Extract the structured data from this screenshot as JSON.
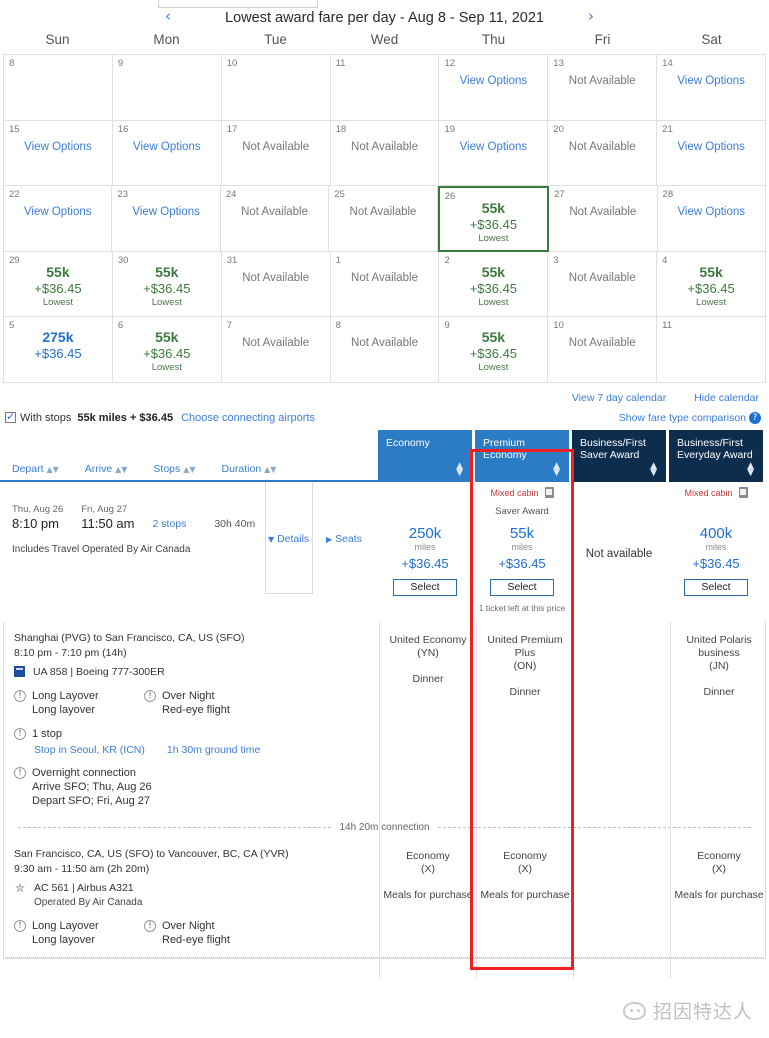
{
  "calendar": {
    "title": "Lowest award fare per day - Aug 8 - Sep 11, 2021",
    "prev_icon": "‹",
    "next_icon": "›",
    "weekdays": [
      "Sun",
      "Mon",
      "Tue",
      "Wed",
      "Thu",
      "Fri",
      "Sat"
    ],
    "link_label": "View Options",
    "na_label": "Not Available",
    "lowest_label": "Lowest",
    "colors": {
      "lowest_green": "#3d7a3d",
      "price_blue": "#1f6fd0",
      "link_blue": "#3b7dd8",
      "selected_border": "#3d7a3d"
    },
    "rows": [
      [
        {
          "day": "8",
          "state": "empty"
        },
        {
          "day": "9",
          "state": "empty"
        },
        {
          "day": "10",
          "state": "empty"
        },
        {
          "day": "11",
          "state": "empty"
        },
        {
          "day": "12",
          "state": "link"
        },
        {
          "day": "13",
          "state": "na"
        },
        {
          "day": "14",
          "state": "link"
        }
      ],
      [
        {
          "day": "15",
          "state": "link"
        },
        {
          "day": "16",
          "state": "link"
        },
        {
          "day": "17",
          "state": "na"
        },
        {
          "day": "18",
          "state": "na"
        },
        {
          "day": "19",
          "state": "link"
        },
        {
          "day": "20",
          "state": "na"
        },
        {
          "day": "21",
          "state": "link"
        }
      ],
      [
        {
          "day": "22",
          "state": "link"
        },
        {
          "day": "23",
          "state": "link"
        },
        {
          "day": "24",
          "state": "na"
        },
        {
          "day": "25",
          "state": "na"
        },
        {
          "day": "26",
          "state": "fare",
          "miles": "55k",
          "cash": "+$36.45",
          "lowest": "Lowest",
          "tone": "green",
          "selected": true
        },
        {
          "day": "27",
          "state": "na"
        },
        {
          "day": "28",
          "state": "link"
        }
      ],
      [
        {
          "day": "29",
          "state": "fare",
          "miles": "55k",
          "cash": "+$36.45",
          "lowest": "Lowest",
          "tone": "green"
        },
        {
          "day": "30",
          "state": "fare",
          "miles": "55k",
          "cash": "+$36.45",
          "lowest": "Lowest",
          "tone": "green"
        },
        {
          "day": "31",
          "state": "na"
        },
        {
          "day": "1",
          "state": "na"
        },
        {
          "day": "2",
          "state": "fare",
          "miles": "55k",
          "cash": "+$36.45",
          "lowest": "Lowest",
          "tone": "green"
        },
        {
          "day": "3",
          "state": "na"
        },
        {
          "day": "4",
          "state": "fare",
          "miles": "55k",
          "cash": "+$36.45",
          "lowest": "Lowest",
          "tone": "green"
        }
      ],
      [
        {
          "day": "5",
          "state": "fare",
          "miles": "275k",
          "cash": "+$36.45",
          "lowest": "",
          "tone": "blue"
        },
        {
          "day": "6",
          "state": "fare",
          "miles": "55k",
          "cash": "+$36.45",
          "lowest": "Lowest",
          "tone": "green"
        },
        {
          "day": "7",
          "state": "na"
        },
        {
          "day": "8",
          "state": "na"
        },
        {
          "day": "9",
          "state": "fare",
          "miles": "55k",
          "cash": "+$36.45",
          "lowest": "Lowest",
          "tone": "green"
        },
        {
          "day": "10",
          "state": "na"
        },
        {
          "day": "11",
          "state": "empty"
        }
      ]
    ],
    "footer_links": [
      "View 7 day calendar",
      "Hide calendar"
    ]
  },
  "filters": {
    "with_stops_label": "With stops",
    "with_stops_price": "55k miles + $36.45",
    "choose_airports": "Choose connecting airports",
    "fare_comparison": "Show fare type comparison",
    "help_icon": "?"
  },
  "sort": {
    "items": [
      "Depart",
      "Arrive",
      "Stops",
      "Duration"
    ],
    "sort_icon": "▴▾"
  },
  "fare_columns": [
    {
      "label": "Economy",
      "tone": "lite"
    },
    {
      "label": "Premium Economy",
      "tone": "lite"
    },
    {
      "label": "Business/First Saver Award",
      "tone": "dark"
    },
    {
      "label": "Business/First Everyday Award",
      "tone": "dark"
    }
  ],
  "flight": {
    "depart_date": "Thu, Aug 26",
    "depart_time": "8:10 pm",
    "arrive_date": "Fri, Aug 27",
    "arrive_time": "11:50 am",
    "stops": "2 stops",
    "duration": "30h 40m",
    "note": "Includes Travel Operated By Air Canada",
    "details_label": "Details",
    "details_icon": "▼",
    "seats_label": "Seats",
    "seats_icon": "▶"
  },
  "fares": [
    {
      "mixed_cabin": "",
      "saver_label": "",
      "miles": "250k",
      "miles_unit": "miles",
      "cash": "+$36.45",
      "select_label": "Select",
      "ticket_left": "",
      "not_available": ""
    },
    {
      "mixed_cabin": "Mixed cabin",
      "saver_label": "Saver Award",
      "miles": "55k",
      "miles_unit": "miles",
      "cash": "+$36.45",
      "select_label": "Select",
      "ticket_left": "1 ticket left at this price",
      "not_available": "",
      "highlighted": true
    },
    {
      "mixed_cabin": "",
      "saver_label": "",
      "miles": "",
      "miles_unit": "",
      "cash": "",
      "select_label": "",
      "ticket_left": "",
      "not_available": "Not available"
    },
    {
      "mixed_cabin": "Mixed cabin",
      "saver_label": "",
      "miles": "400k",
      "miles_unit": "miles",
      "cash": "+$36.45",
      "select_label": "Select",
      "ticket_left": "",
      "not_available": ""
    }
  ],
  "itinerary": {
    "segments": [
      {
        "route": "Shanghai (PVG) to San Francisco, CA, US (SFO)",
        "times": "8:10 pm - 7:10 pm (14h)",
        "flight": "UA 858 | Boeing 777-300ER",
        "operated_by": "",
        "logo": "united-logo",
        "warnings": [
          {
            "title": "Long Layover",
            "sub": "Long layover"
          },
          {
            "title": "Over Night",
            "sub": "Red-eye flight"
          }
        ],
        "stop_title": "1 stop",
        "stop_link": "Stop in Seoul, KR (ICN)",
        "stop_ground": "1h 30m ground time",
        "overnight_title": "Overnight connection",
        "overnight_lines": [
          "Arrive SFO; Thu, Aug 26",
          "Depart SFO; Fri, Aug 27"
        ],
        "cabins": [
          {
            "name": "United Economy\n(YN)",
            "meal": "Dinner"
          },
          {
            "name": "United Premium Plus\n(ON)",
            "meal": "Dinner"
          },
          {
            "name": "",
            "meal": ""
          },
          {
            "name": "United Polaris business\n(JN)",
            "meal": "Dinner"
          }
        ]
      },
      {
        "route": "San Francisco, CA, US (SFO) to Vancouver, BC, CA (YVR)",
        "times": "9:30 am - 11:50 am (2h 20m)",
        "flight": "AC 561 | Airbus A321",
        "operated_by": "Operated By Air Canada",
        "logo": "air-canada-logo",
        "warnings": [
          {
            "title": "Long Layover",
            "sub": "Long layover"
          },
          {
            "title": "Over Night",
            "sub": "Red-eye flight"
          }
        ],
        "stop_title": "",
        "stop_link": "",
        "stop_ground": "",
        "overnight_title": "",
        "overnight_lines": [],
        "cabins": [
          {
            "name": "Economy\n(X)",
            "meal": "Meals for purchase"
          },
          {
            "name": "Economy\n(X)",
            "meal": "Meals for purchase"
          },
          {
            "name": "",
            "meal": ""
          },
          {
            "name": "Economy\n(X)",
            "meal": "Meals for purchase"
          }
        ]
      }
    ],
    "connection_label": "14h 20m connection"
  },
  "watermark": {
    "text": "招因特达人"
  }
}
